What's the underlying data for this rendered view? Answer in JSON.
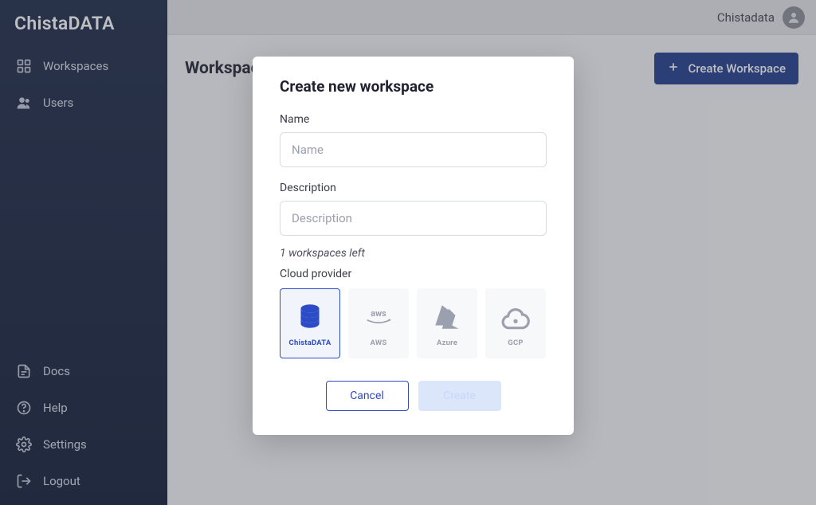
{
  "brand": "ChistaDATA",
  "sidebar": {
    "top": [
      {
        "label": "Workspaces",
        "icon": "grid-icon"
      },
      {
        "label": "Users",
        "icon": "users-icon"
      }
    ],
    "bottom": [
      {
        "label": "Docs",
        "icon": "doc-icon"
      },
      {
        "label": "Help",
        "icon": "help-icon"
      },
      {
        "label": "Settings",
        "icon": "settings-icon"
      },
      {
        "label": "Logout",
        "icon": "logout-icon"
      }
    ]
  },
  "topbar": {
    "username": "Chistadata"
  },
  "page": {
    "title": "Workspace",
    "create_label": "Create Workspace"
  },
  "modal": {
    "title": "Create new workspace",
    "name_label": "Name",
    "name_placeholder": "Name",
    "desc_label": "Description",
    "desc_placeholder": "Description",
    "hint": "1 workspaces left",
    "provider_label": "Cloud provider",
    "providers": [
      {
        "name": "ChistaDATA",
        "selected": true
      },
      {
        "name": "AWS",
        "selected": false
      },
      {
        "name": "Azure",
        "selected": false
      },
      {
        "name": "GCP",
        "selected": false
      }
    ],
    "cancel": "Cancel",
    "create": "Create"
  }
}
